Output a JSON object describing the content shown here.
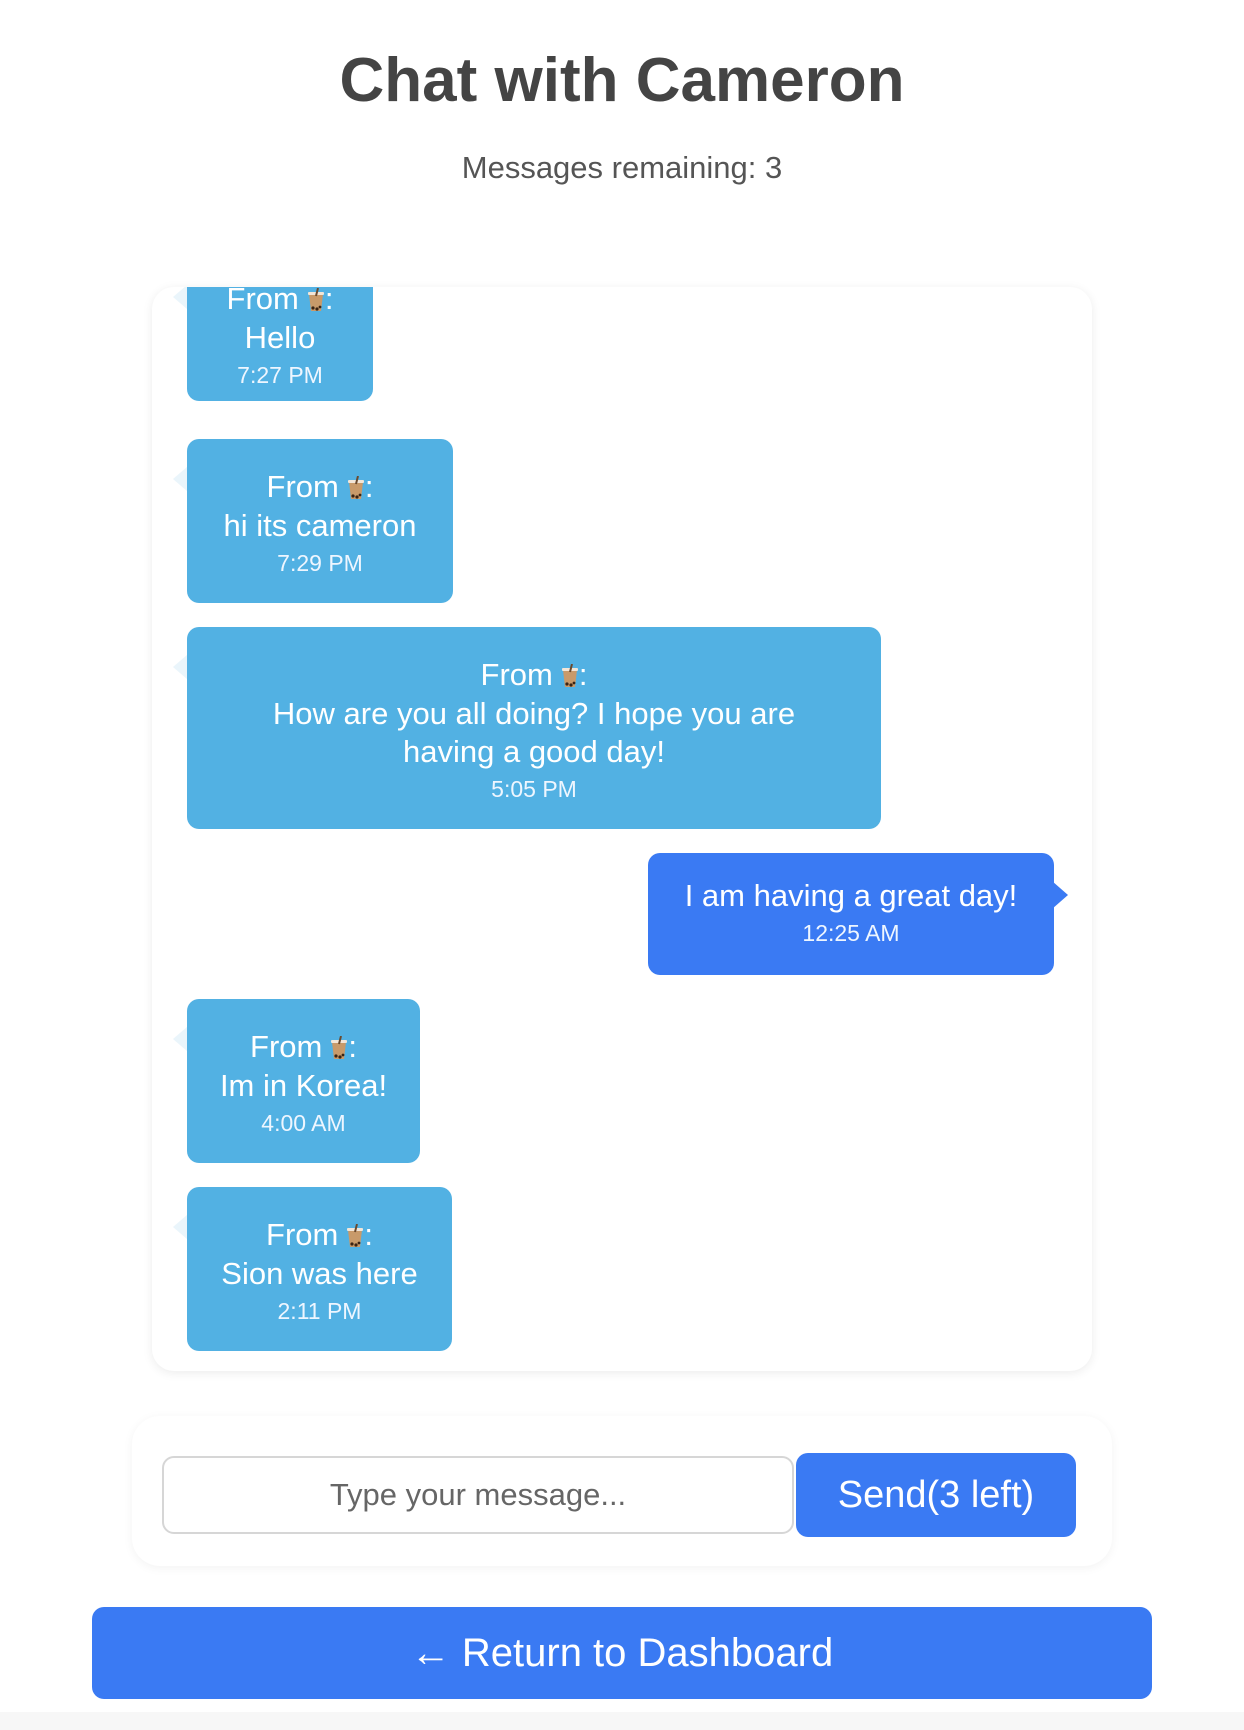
{
  "header": {
    "title": "Chat with Cameron",
    "remaining": "Messages remaining: 3"
  },
  "messages": [
    {
      "direction": "incoming",
      "from": "From",
      "emoji": "bubble-tea-icon",
      "text": "Hello",
      "time": "7:27 PM"
    },
    {
      "direction": "incoming",
      "from": "From",
      "emoji": "bubble-tea-icon",
      "text": "hi its cameron",
      "time": "7:29 PM"
    },
    {
      "direction": "incoming",
      "from": "From",
      "emoji": "bubble-tea-icon",
      "text": "How are you all doing? I hope you are having a good day!",
      "time": "5:05 PM"
    },
    {
      "direction": "outgoing",
      "text": "I am having a great day!",
      "time": "12:25 AM"
    },
    {
      "direction": "incoming",
      "from": "From",
      "emoji": "bubble-tea-icon",
      "text": "Im in Korea!",
      "time": "4:00 AM"
    },
    {
      "direction": "incoming",
      "from": "From",
      "emoji": "bubble-tea-icon",
      "text": "Sion was here",
      "time": "2:11 PM"
    }
  ],
  "composer": {
    "placeholder": "Type your message...",
    "value": "",
    "send_label": "Send(3 left)"
  },
  "nav": {
    "return_label": "← Return to Dashboard"
  },
  "colors": {
    "incoming_bubble": "#52b1e3",
    "outgoing_bubble": "#3a7af3",
    "primary_button": "#3a7af3",
    "title_text": "#444444"
  }
}
